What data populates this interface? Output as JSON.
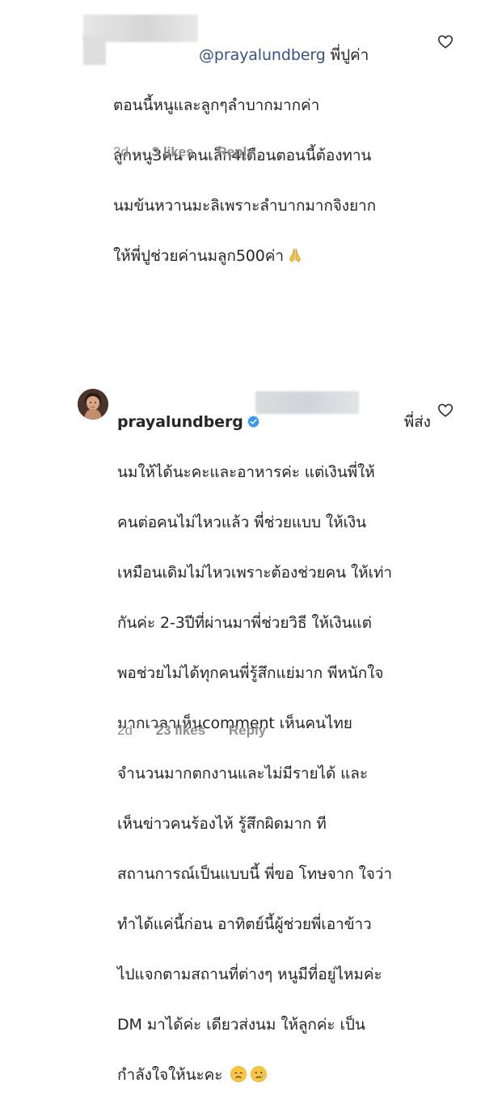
{
  "comments": [
    {
      "mention": "@prayalundberg",
      "lines": [
        " พี่ปูค่า",
        "ตอนนี้หนูและลูกๆลำบากมากค่า",
        "ลูกหนู3คน คนเล็ก4เดือนตอนนี้ต้องทาน",
        "นมข้นหวานมะลิเพราะลำบากมากจิงยาก",
        "ให้พี่ปูช่วยค่านมลูก500ค่า"
      ],
      "time": "3d",
      "likes": "3 likes",
      "reply": "Reply",
      "emoji": "folded-hands-emoji",
      "heart_icon": "heart-outline-icon"
    },
    {
      "username": "prayalundberg",
      "verified_icon": "verified-badge-icon",
      "lines": [
        "พี่ส่ง",
        "นมให้ได้นะคะและอาหารค่ะ แต่เงินพี่ให้",
        "คนต่อคนไม่ไหวแล้ว พี่ช่วยแบบ ให้เงิน",
        "เหมือนเดิมไม่ไหวเพราะต้องช่วยคน ให้เท่า",
        "กันค่ะ 2-3ปีที่ผ่านมาพี่ช่วยวิธี ให้เงินแต่",
        "พอช่วยไม่ได้ทุกคนพี่รู้สึกแย่มาก พีหนักใจ",
        "มากเวลาเห็นcomment เห็นคนไทย",
        "จำนวนมากตกงานและไม่มีรายได้ และ",
        "เห็นข่าวคนร้องไห้ รู้สึกผิดมาก ที",
        "สถานการณ์เป็นแบบนี้ พี่ขอ โทษจาก ใจว่า",
        "ทำได้แค่นี้ก่อน อาทิตย์นี้ผู้ช่วยพี่เอาข้าว",
        "ไปแจกตามสถานที่ต่างๆ หนูมีที่อยู่ไหมค่ะ",
        "DM มาได้ค่ะ เดียวส่งนม ให้ลูกค่ะ เป็น",
        "กำลังใจให้นะคะ"
      ],
      "time": "2d",
      "likes": "23 likes",
      "reply": "Reply",
      "emojis": [
        "disappointed-face-emoji",
        "crying-face-emoji"
      ],
      "heart_icon": "heart-outline-icon"
    }
  ],
  "colors": {
    "text": "#262626",
    "mention": "#385185",
    "meta": "#8e8e8e",
    "verified": "#3897f0"
  }
}
